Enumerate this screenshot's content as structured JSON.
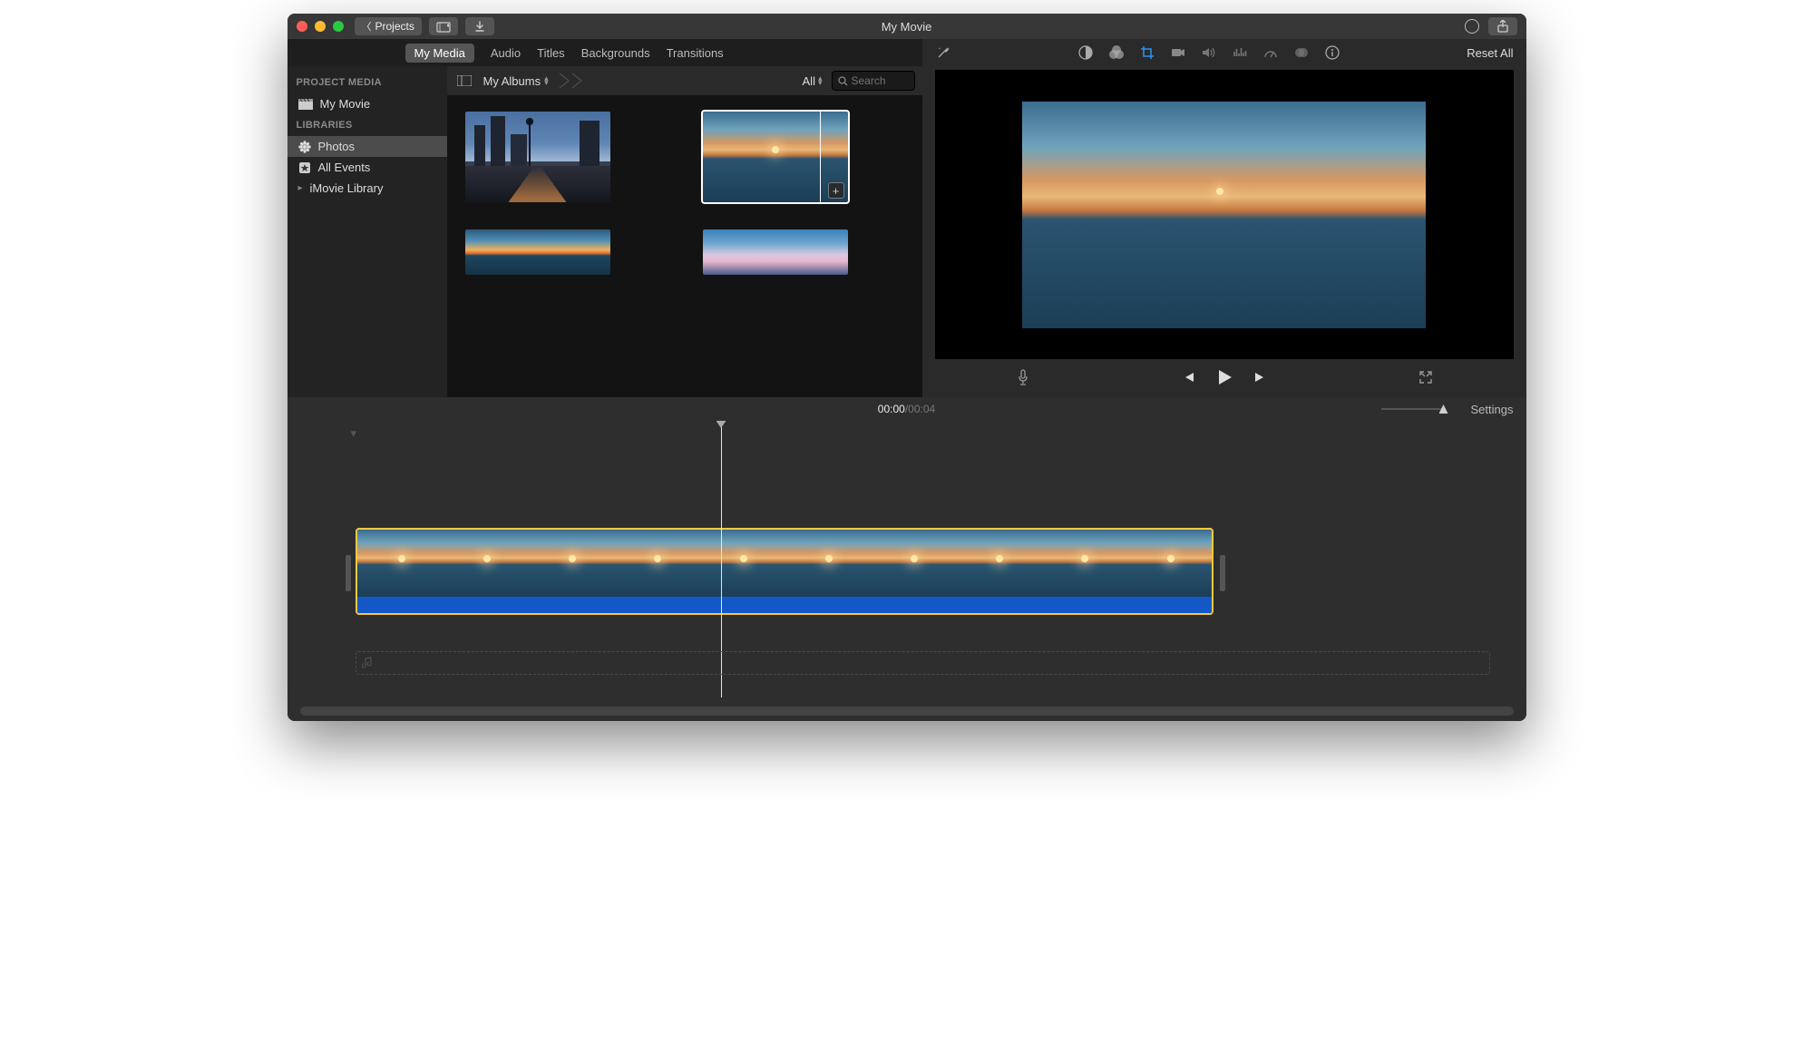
{
  "title": "My Movie",
  "titlebar": {
    "back_label": "Projects"
  },
  "tabs": [
    "My Media",
    "Audio",
    "Titles",
    "Backgrounds",
    "Transitions"
  ],
  "active_tab": "My Media",
  "sidebar": {
    "section1": "PROJECT MEDIA",
    "project": "My Movie",
    "section2": "LIBRARIES",
    "items": [
      "Photos",
      "All Events",
      "iMovie Library"
    ],
    "selected": "Photos"
  },
  "browser": {
    "album_label": "My Albums",
    "filter_label": "All",
    "search_placeholder": "Search"
  },
  "viewer": {
    "reset_label": "Reset All"
  },
  "timeline": {
    "current": "00:00",
    "separator": " / ",
    "duration": "00:04",
    "settings_label": "Settings"
  }
}
